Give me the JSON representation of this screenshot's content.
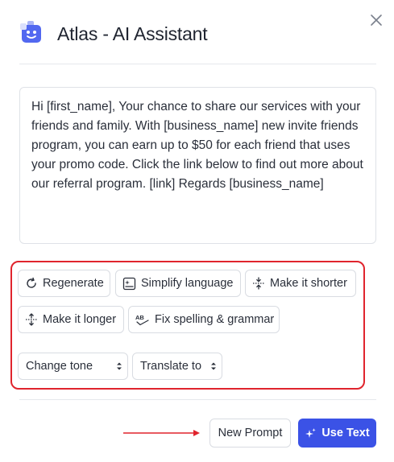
{
  "header": {
    "title": "Atlas - AI Assistant",
    "logo_icon": "robot-logo-icon",
    "close_icon": "close-icon"
  },
  "message": {
    "text": "Hi [first_name], Your chance to share our services with your friends and family. With [business_name] new invite friends program, you can earn up to $50 for each friend that uses your promo code. Click the link below to find out more about our referral program. [link] Regards [business_name]"
  },
  "actions": {
    "regenerate": "Regenerate",
    "simplify": "Simplify language",
    "shorter": "Make it shorter",
    "longer": "Make it longer",
    "spelling": "Fix spelling & grammar"
  },
  "selects": {
    "tone": "Change tone",
    "translate": "Translate to"
  },
  "footer": {
    "new_prompt": "New Prompt",
    "use_text": "Use Text"
  },
  "colors": {
    "accent": "#3b52e6",
    "highlight": "#e0242d"
  }
}
